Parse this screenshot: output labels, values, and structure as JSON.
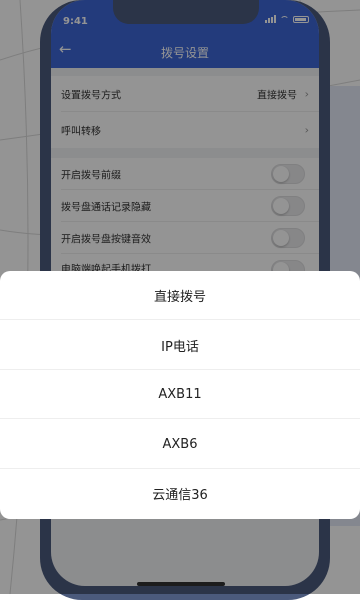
{
  "status_bar": {
    "time": "9:41"
  },
  "header": {
    "back_icon": "arrow-left-icon",
    "title": "拨号设置"
  },
  "settings": {
    "dial_method": {
      "label": "设置拨号方式",
      "value": "直接拨号"
    },
    "call_forward": {
      "label": "呼叫转移"
    },
    "toggles": [
      {
        "label": "开启拨号前缀",
        "on": false
      },
      {
        "label": "拨号盘通话记录隐藏",
        "on": false
      },
      {
        "label": "开启拨号盘按键音效",
        "on": false
      },
      {
        "label": "电脑端唤起手机拨打",
        "on": false
      }
    ]
  },
  "action_sheet": {
    "options": [
      "直接拨号",
      "IP电话",
      "AXB11",
      "AXB6",
      "云通信36"
    ]
  },
  "colors": {
    "accent": "#3d66d6",
    "phone_frame": "#4b5a7c",
    "overlay": "rgba(0,0,0,0.42)"
  }
}
